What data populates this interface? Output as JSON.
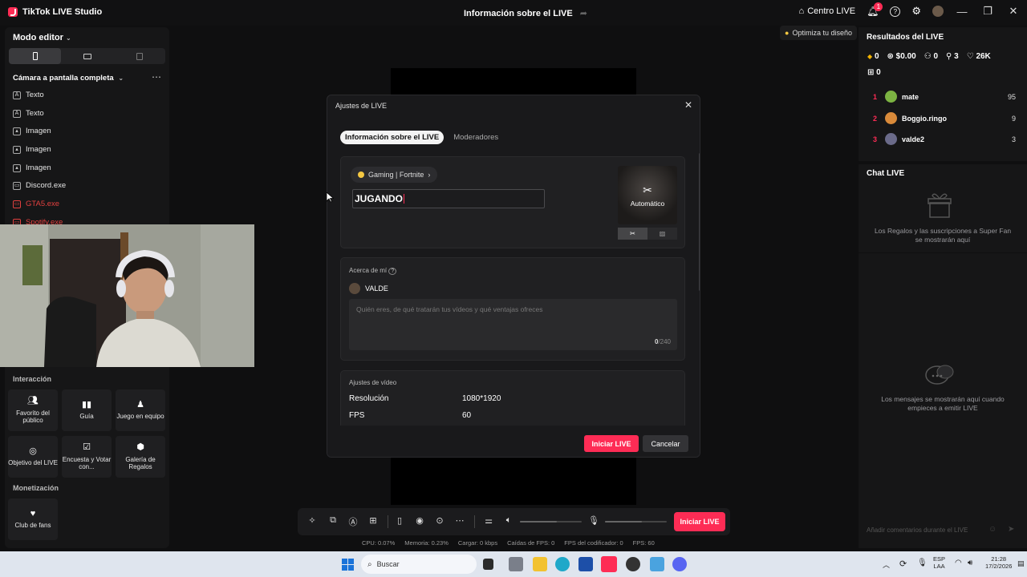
{
  "titlebar": {
    "app_name": "TikTok LIVE Studio",
    "center_title": "Información sobre el LIVE",
    "centro_live": "Centro LIVE",
    "notification_count": "1"
  },
  "left": {
    "mode_label": "Modo editor",
    "scene_label": "Cámara a pantalla completa",
    "sources": [
      {
        "label": "Texto"
      },
      {
        "label": "Texto"
      },
      {
        "label": "Imagen"
      },
      {
        "label": "Imagen"
      },
      {
        "label": "Imagen"
      },
      {
        "label": "Discord.exe"
      },
      {
        "label": "GTA5.exe"
      },
      {
        "label": "Spotify.exe"
      }
    ],
    "interaccion_heading": "Interacción",
    "interaccion_tiles": [
      {
        "label": "Favorito del público"
      },
      {
        "label": "Guía"
      },
      {
        "label": "Juego en equipo"
      },
      {
        "label": "Objetivo del LIVE"
      },
      {
        "label": "Encuesta y Votar con..."
      },
      {
        "label": "Galería de Regalos"
      }
    ],
    "monetizacion_heading": "Monetización",
    "club_de_fans": "Club de fans"
  },
  "canvas": {
    "optimize_hint": "Optimiza tu diseño"
  },
  "toolbar": {
    "start_live": "Iniciar LIVE",
    "volume_level": 0.6,
    "mic_level": 0.6
  },
  "stats": {
    "cpu": "CPU: 0.07%",
    "memoria": "Memoria: 0.23%",
    "cargar": "Cargar: 0 kbps",
    "caidas": "Caídas de FPS: 0",
    "fps_codificador": "FPS del codificador: 0",
    "fps": "FPS: 60"
  },
  "right": {
    "results_title": "Resultados del LIVE",
    "stat_gems": "0",
    "stat_money": "$0.00",
    "stat_people": "0",
    "stat_share": "3",
    "stat_likes": "26K",
    "stat_gift": "0",
    "ranking": [
      {
        "rank": "1",
        "name": "mate",
        "score": "95"
      },
      {
        "rank": "2",
        "name": "Boggio.ringo",
        "score": "9"
      },
      {
        "rank": "3",
        "name": "valde2",
        "score": "3"
      }
    ],
    "chat_title": "Chat LIVE",
    "gifts_msg": "Los Regalos y las suscripciones a Super Fan se mostrarán aquí",
    "messages_msg": "Los mensajes se mostrarán aquí cuando empieces a emitir LIVE",
    "comment_placeholder": "Añadir comentarios durante el LIVE"
  },
  "modal": {
    "title": "Ajustes de LIVE",
    "tab_info": "Información sobre el LIVE",
    "tab_mods": "Moderadores",
    "category": "Gaming | Fortnite",
    "live_title": "JUGANDO",
    "cover_label": "Automático",
    "about_label": "Acerca de mí",
    "username": "VALDE",
    "bio_placeholder": "Quién eres, de qué tratarán tus vídeos y qué ventajas ofreces",
    "bio_count": "0",
    "bio_max": "/240",
    "video_label": "Ajustes de vídeo",
    "resolution_label": "Resolución",
    "resolution_value": "1080*1920",
    "fps_label": "FPS",
    "fps_value": "60",
    "start_button": "Iniciar LIVE",
    "cancel_button": "Cancelar"
  },
  "taskbar": {
    "search_placeholder": "Buscar",
    "lang_top": "ESP",
    "lang_bottom": "LAA",
    "time": "21:28",
    "date": "17/2/2026"
  }
}
